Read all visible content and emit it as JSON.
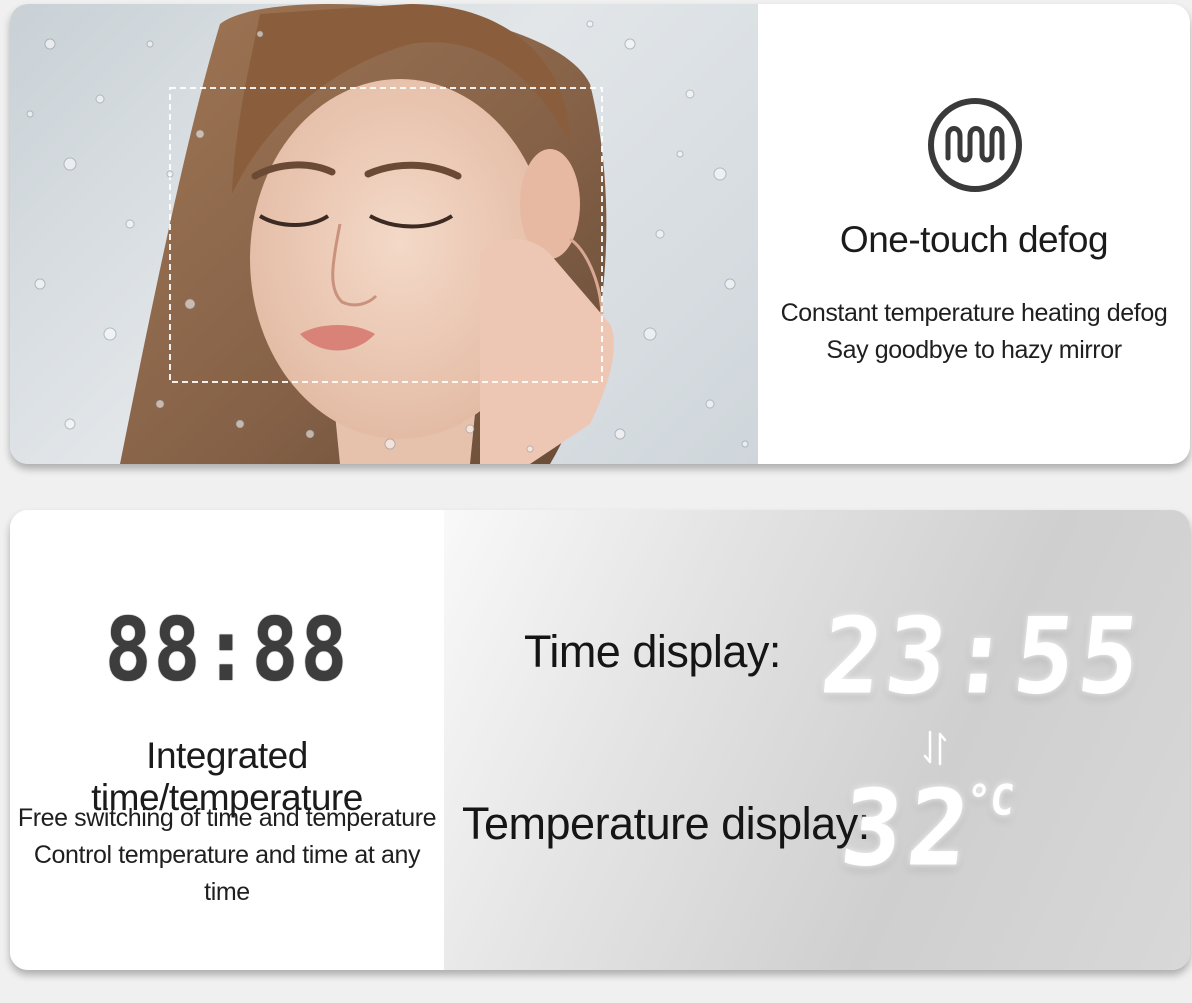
{
  "defog": {
    "title": "One-touch defog",
    "desc_line1": "Constant temperature heating defog",
    "desc_line2": "Say goodbye to hazy mirror",
    "icon": "heating-coil-icon"
  },
  "time_temp": {
    "seg_glyph": "88:88",
    "title": "Integrated time/temperature",
    "desc_line1": "Free switching of time and temperature",
    "desc_line2": "Control temperature and time at any time",
    "time_label": "Time display:",
    "time_value": "23:55",
    "temp_label": "Temperature display:",
    "temp_value": "32",
    "temp_unit": "°C",
    "switch_icon": "swap-arrows-icon"
  }
}
